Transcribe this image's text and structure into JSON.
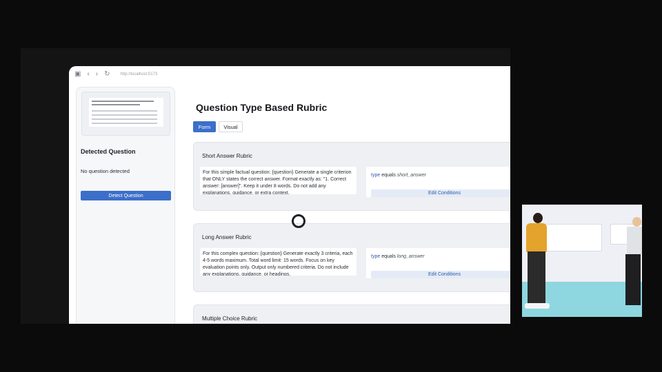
{
  "browser": {
    "url": "http://localhost:5173"
  },
  "sidebar": {
    "detected_title": "Detected Question",
    "no_question": "No question detected",
    "detect_button": "Detect Question"
  },
  "main": {
    "title": "Question Type Based Rubric",
    "tabs": [
      {
        "label": "Form",
        "active": true
      },
      {
        "label": "Visual",
        "active": false
      }
    ],
    "rubrics": [
      {
        "title": "Short Answer Rubric",
        "prompt": "For this simple factual question: {question} Generate a single criterion that ONLY states the correct answer. Format exactly as: \"1. Correct answer: [answer]\". Keep it under 8 words. Do not add any explanations, guidance, or extra context.",
        "condition_field": "type",
        "condition_op": "equals",
        "condition_value": "short_answer",
        "edit_label": "Edit Conditions"
      },
      {
        "title": "Long Answer Rubric",
        "prompt": "For this complex question: {question} Generate exactly 3 criteria, each 4-5 words maximum. Total word limit: 15 words. Focus on key evaluation points only. Output only numbered criteria. Do not include any explanations, guidance, or headings.",
        "condition_field": "type",
        "condition_op": "equals",
        "condition_value": "long_answer",
        "edit_label": "Edit Conditions"
      },
      {
        "title": "Multiple Choice Rubric"
      }
    ]
  },
  "colors": {
    "accent": "#3b6fc9",
    "background": "#0b0b0b",
    "card": "#eef0f3"
  }
}
